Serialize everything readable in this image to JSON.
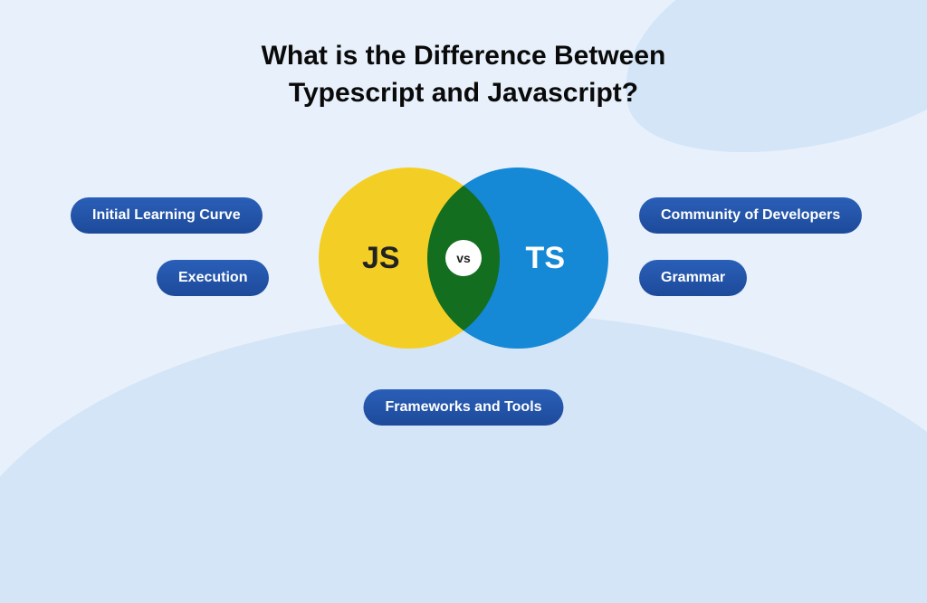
{
  "title_line1": "What is the Difference Between",
  "title_line2": "Typescript and Javascript?",
  "venn": {
    "left_label": "JS",
    "right_label": "TS",
    "center_label": "vs"
  },
  "pills": {
    "left_top": "Initial Learning Curve",
    "left_bottom": "Execution",
    "right_top": "Community of Developers",
    "right_bottom": "Grammar",
    "bottom_center": "Frameworks and Tools"
  },
  "colors": {
    "js_circle": "#f3cf26",
    "ts_circle": "#1588d6",
    "pill_bg": "#1d4a9a",
    "page_bg": "#e8f1fb"
  }
}
